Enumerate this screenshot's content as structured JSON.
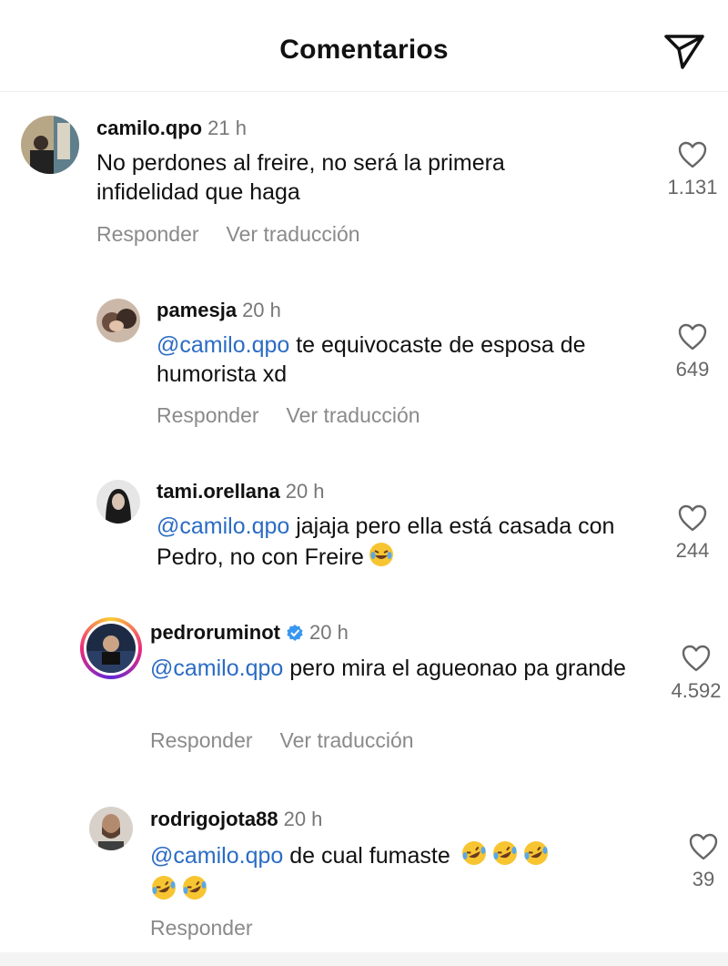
{
  "header": {
    "title": "Comentarios"
  },
  "comments": [
    {
      "username": "camilo.qpo",
      "time": "21 h",
      "text": "No perdones al freire, no será la primera infidelidad que haga",
      "likes": "1.131",
      "reply_label": "Responder",
      "translate_label": "Ver traducción"
    },
    {
      "username": "pamesja",
      "time": "20 h",
      "mention": "@camilo.qpo",
      "text": " te equivocaste de esposa de humorista xd",
      "likes": "649",
      "reply_label": "Responder",
      "translate_label": "Ver traducción"
    },
    {
      "username": "tami.orellana",
      "time": "20 h",
      "mention": "@camilo.qpo",
      "text": " jajaja pero ella está casada con Pedro, no con Freire",
      "likes": "244"
    },
    {
      "username": "pedroruminot",
      "time": "20 h",
      "mention": "@camilo.qpo",
      "text": " pero mira el agueonao pa grande",
      "likes": "4.592",
      "reply_label": "Responder",
      "translate_label": "Ver traducción"
    },
    {
      "username": "rodrigojota88",
      "time": "20 h",
      "mention": "@camilo.qpo",
      "text": " de cual fumaste",
      "likes": "39",
      "reply_label": "Responder"
    }
  ],
  "colors": {
    "mention": "#2b6cc4",
    "verified": "#3897f0",
    "secondary": "#8a8a8a"
  },
  "icons": {
    "send": "send-icon",
    "like": "heart-icon",
    "emoji": "rofl-emoji-icon",
    "verified": "verified-badge-icon"
  }
}
